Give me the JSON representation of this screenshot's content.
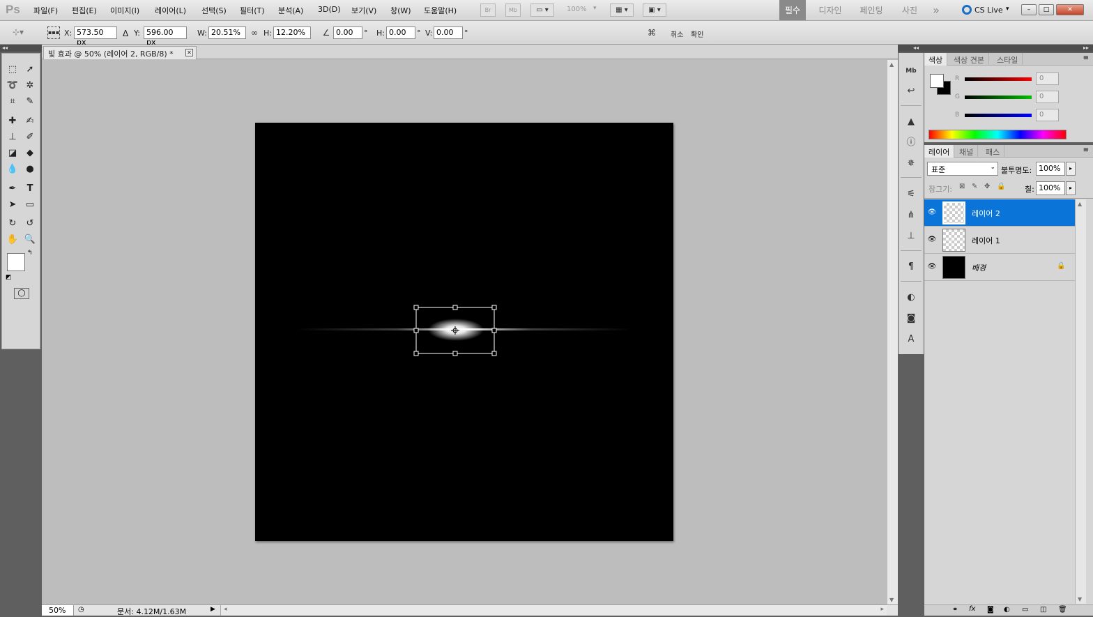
{
  "app": {
    "logo": "Ps"
  },
  "menu": [
    "파일(F)",
    "편집(E)",
    "이미지(I)",
    "레이어(L)",
    "선택(S)",
    "필터(T)",
    "분석(A)",
    "3D(D)",
    "보기(V)",
    "창(W)",
    "도움말(H)"
  ],
  "toolbar_top": {
    "bridge": "Br",
    "mini": "Mb",
    "zoom": "100%"
  },
  "workspaces": [
    "필수",
    "디자인",
    "페인팅",
    "사진"
  ],
  "workspace_more": "»",
  "cslive": "CS Live",
  "window_controls": {
    "minimize": "–",
    "maximize": "□",
    "close": "✕"
  },
  "options": {
    "x_label": "X:",
    "x_value": "573.50 px",
    "y_label": "Y:",
    "y_value": "596.00 px",
    "w_label": "W:",
    "w_value": "20.51%",
    "h_label": "H:",
    "h_value": "12.20%",
    "angle_value": "0.00",
    "hskew_label": "H:",
    "hskew_value": "0.00",
    "vskew_label": "V:",
    "vskew_value": "0.00",
    "degree": "°",
    "cancel": "취소",
    "commit": "확인"
  },
  "document": {
    "tab_title": "빛 효과 @ 50% (레이어 2, RGB/8) *",
    "close": "✕"
  },
  "status": {
    "zoom": "50%",
    "doc_info": "문서: 4.12M/1.63M"
  },
  "color_panel": {
    "tabs": [
      "색상",
      "색상 견본",
      "스타일"
    ],
    "channels": [
      {
        "label": "R",
        "value": "0",
        "color": "#ff0000"
      },
      {
        "label": "G",
        "value": "0",
        "color": "#00c000"
      },
      {
        "label": "B",
        "value": "0",
        "color": "#0000ff"
      }
    ]
  },
  "layers_panel": {
    "tabs": [
      "레이어",
      "채널",
      "패스"
    ],
    "blend_mode": "표준",
    "opacity_label": "불투명도:",
    "opacity_value": "100%",
    "lock_label": "잠그기:",
    "fill_label": "칠:",
    "fill_value": "100%",
    "layers": [
      {
        "name": "레이어 2",
        "selected": true,
        "thumb": "transparent"
      },
      {
        "name": "레이어 1",
        "selected": false,
        "thumb": "transparent"
      },
      {
        "name": "배경",
        "selected": false,
        "thumb": "black",
        "locked": true
      }
    ]
  },
  "colors": {
    "accent": "#0a74d9",
    "canvas": "#000000",
    "foreground": "#ffffff",
    "background": "#000000"
  }
}
